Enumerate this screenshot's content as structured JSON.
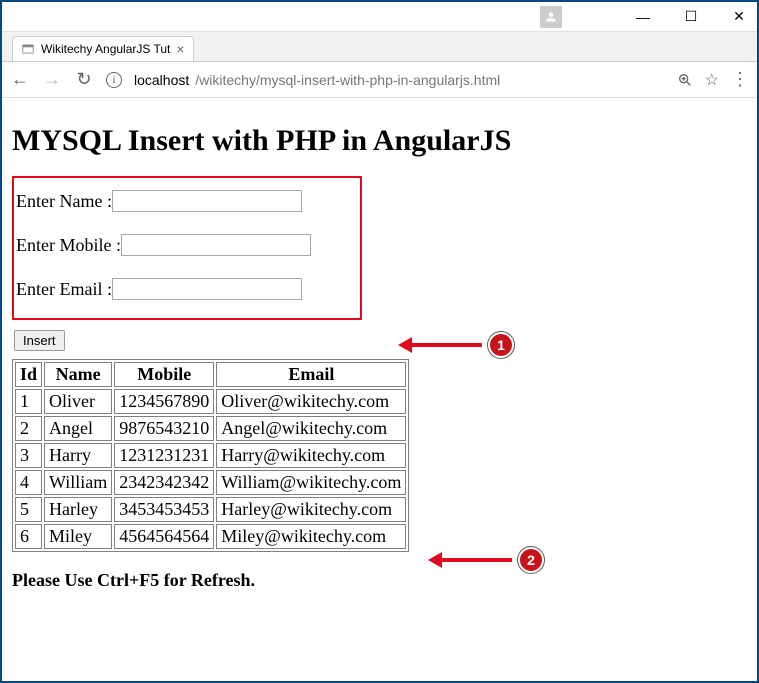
{
  "window": {
    "minimize": "—",
    "maximize": "☐",
    "close": "✕"
  },
  "tab": {
    "title": "Wikitechy AngularJS Tut",
    "close": "×"
  },
  "addr": {
    "back": "←",
    "forward": "→",
    "reload": "↻",
    "info": "i",
    "host": "localhost",
    "path": "/wikitechy/mysql-insert-with-php-in-angularjs.html",
    "star": "☆",
    "menu": "⋮"
  },
  "page": {
    "heading": "MYSQL Insert with PHP in AngularJS",
    "form": {
      "name_label": "Enter Name : ",
      "mobile_label": "Enter Mobile : ",
      "email_label": "Enter Email : ",
      "name_value": "",
      "mobile_value": "",
      "email_value": ""
    },
    "insert_btn": "Insert",
    "table": {
      "headers": {
        "id": "Id",
        "name": "Name",
        "mobile": "Mobile",
        "email": "Email"
      },
      "rows": [
        {
          "id": "1",
          "name": "Oliver",
          "mobile": "1234567890",
          "email": "Oliver@wikitechy.com"
        },
        {
          "id": "2",
          "name": "Angel",
          "mobile": "9876543210",
          "email": "Angel@wikitechy.com"
        },
        {
          "id": "3",
          "name": "Harry",
          "mobile": "1231231231",
          "email": "Harry@wikitechy.com"
        },
        {
          "id": "4",
          "name": "William",
          "mobile": "2342342342",
          "email": "William@wikitechy.com"
        },
        {
          "id": "5",
          "name": "Harley",
          "mobile": "3453453453",
          "email": "Harley@wikitechy.com"
        },
        {
          "id": "6",
          "name": "Miley",
          "mobile": "4564564564",
          "email": "Miley@wikitechy.com"
        }
      ]
    },
    "refresh_note": "Please Use Ctrl+F5 for Refresh.",
    "callouts": {
      "one": "1",
      "two": "2"
    }
  }
}
